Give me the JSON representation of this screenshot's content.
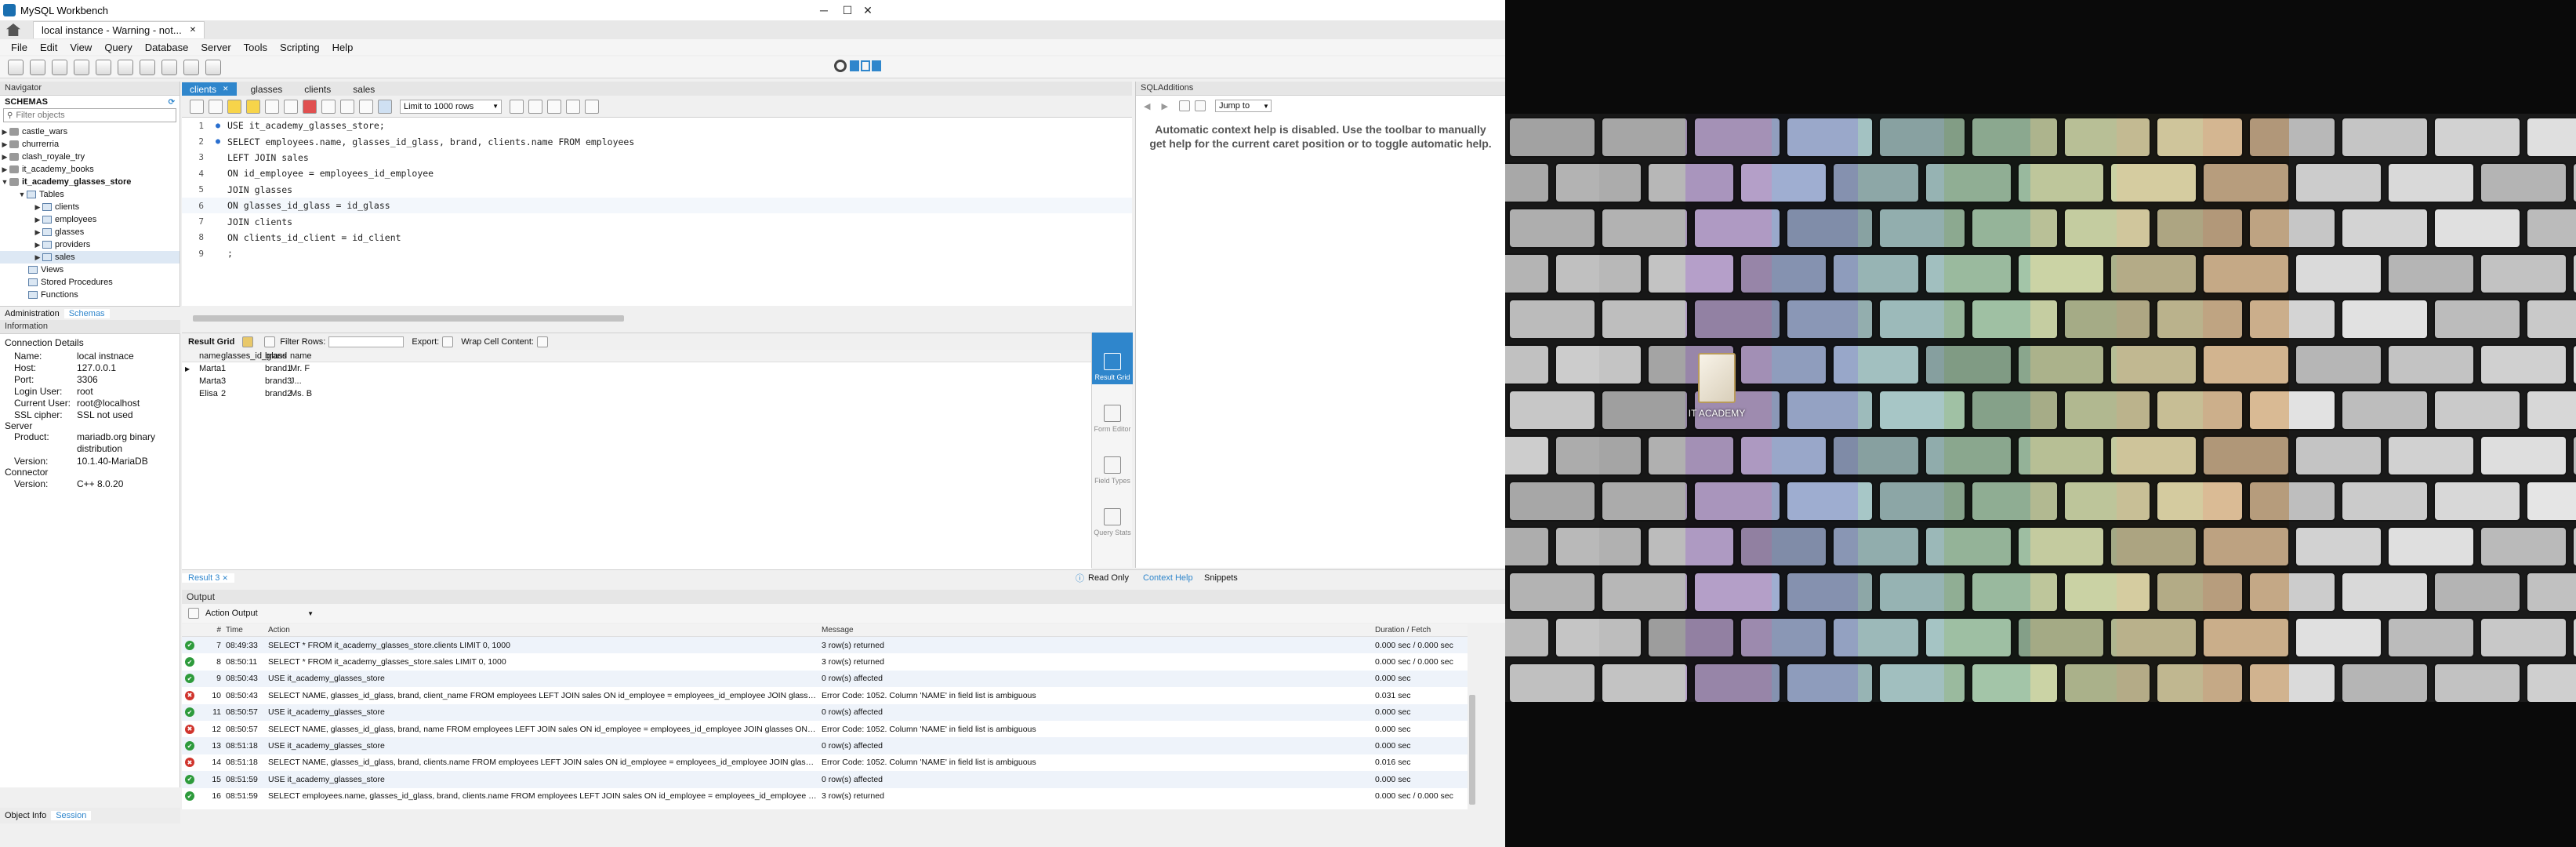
{
  "window": {
    "title": "MySQL Workbench",
    "doc_tab": "local instance - Warning - not...",
    "minimize": "─",
    "maximize": "☐",
    "close": "✕"
  },
  "menu": [
    "File",
    "Edit",
    "View",
    "Query",
    "Database",
    "Server",
    "Tools",
    "Scripting",
    "Help"
  ],
  "navigator": {
    "title": "Navigator",
    "schemas_label": "SCHEMAS",
    "filter_placeholder": "Filter objects",
    "schemas": [
      "castle_wars",
      "churrerria",
      "clash_royale_try",
      "it_academy_books",
      "it_academy_glasses_store"
    ],
    "tables_label": "Tables",
    "tables": [
      "clients",
      "employees",
      "glasses",
      "providers",
      "sales"
    ],
    "other": [
      "Views",
      "Stored Procedures",
      "Functions"
    ],
    "tabs": [
      "Administration",
      "Schemas"
    ]
  },
  "information": {
    "title": "Information",
    "conn_header": "Connection Details",
    "rows": [
      [
        "Name:",
        "local instnace"
      ],
      [
        "Host:",
        "127.0.0.1"
      ],
      [
        "Port:",
        "3306"
      ],
      [
        "Login User:",
        "root"
      ],
      [
        "Current User:",
        "root@localhost"
      ],
      [
        "SSL cipher:",
        "SSL not used"
      ]
    ],
    "server_header": "Server",
    "server_rows": [
      [
        "Product:",
        "mariadb.org binary distribution"
      ],
      [
        "Version:",
        "10.1.40-MariaDB"
      ]
    ],
    "connector_header": "Connector",
    "connector_rows": [
      [
        "Version:",
        "C++ 8.0.20"
      ]
    ],
    "tabs": [
      "Object Info",
      "Session"
    ]
  },
  "editor": {
    "tabs": [
      "clients",
      "glasses",
      "clients",
      "sales"
    ],
    "limit": "Limit to 1000 rows",
    "lines": [
      "USE it_academy_glasses_store;",
      "SELECT employees.name, glasses_id_glass, brand, clients.name FROM employees",
      "LEFT JOIN sales",
      "ON id_employee = employees_id_employee",
      "JOIN glasses",
      "ON glasses_id_glass = id_glass",
      "JOIN clients",
      "ON clients_id_client = id_client",
      ";"
    ]
  },
  "results": {
    "toolbar": {
      "grid": "Result Grid",
      "filter": "Filter Rows:",
      "export": "Export:",
      "wrap": "Wrap Cell Content:"
    },
    "columns": [
      "name",
      "glasses_id_glass",
      "brand",
      "name"
    ],
    "rows": [
      [
        "Marta",
        "1",
        "brand1",
        "Mr. F"
      ],
      [
        "Marta",
        "3",
        "brand3",
        "J..."
      ],
      [
        "Elisa",
        "2",
        "brand2",
        "Ms. B"
      ]
    ],
    "side": [
      "Result Grid",
      "Form Editor",
      "Field Types",
      "Query Stats"
    ],
    "tab": "Result 3",
    "readonly": "Read Only"
  },
  "sql_additions": {
    "title": "SQLAdditions",
    "jump": "Jump to",
    "help": "Automatic context help is disabled. Use the toolbar to manually get help for the current caret position or to toggle automatic help.",
    "tabs": [
      "Context Help",
      "Snippets"
    ]
  },
  "output": {
    "title": "Output",
    "mode": "Action Output",
    "headers": [
      "#",
      "Time",
      "Action",
      "Message",
      "Duration / Fetch"
    ],
    "rows": [
      {
        "ok": true,
        "n": "7",
        "t": "08:49:33",
        "a": "SELECT * FROM it_academy_glasses_store.clients LIMIT 0, 1000",
        "m": "3 row(s) returned",
        "d": "0.000 sec / 0.000 sec"
      },
      {
        "ok": true,
        "n": "8",
        "t": "08:50:11",
        "a": "SELECT * FROM it_academy_glasses_store.sales LIMIT 0, 1000",
        "m": "3 row(s) returned",
        "d": "0.000 sec / 0.000 sec"
      },
      {
        "ok": true,
        "n": "9",
        "t": "08:50:43",
        "a": "USE it_academy_glasses_store",
        "m": "0 row(s) affected",
        "d": "0.000 sec"
      },
      {
        "ok": false,
        "n": "10",
        "t": "08:50:43",
        "a": "SELECT NAME, glasses_id_glass, brand, client_name FROM employees LEFT JOIN sales ON id_employee = employees_id_employee JOIN glasses ...",
        "m": "Error Code: 1052. Column 'NAME' in field list is ambiguous",
        "d": "0.031 sec"
      },
      {
        "ok": true,
        "n": "11",
        "t": "08:50:57",
        "a": "USE it_academy_glasses_store",
        "m": "0 row(s) affected",
        "d": "0.000 sec"
      },
      {
        "ok": false,
        "n": "12",
        "t": "08:50:57",
        "a": "SELECT NAME, glasses_id_glass, brand, name FROM employees LEFT JOIN sales ON id_employee = employees_id_employee JOIN glasses ON gl...",
        "m": "Error Code: 1052. Column 'NAME' in field list is ambiguous",
        "d": "0.000 sec"
      },
      {
        "ok": true,
        "n": "13",
        "t": "08:51:18",
        "a": "USE it_academy_glasses_store",
        "m": "0 row(s) affected",
        "d": "0.000 sec"
      },
      {
        "ok": false,
        "n": "14",
        "t": "08:51:18",
        "a": "SELECT NAME, glasses_id_glass, brand, clients.name FROM employees LEFT JOIN sales ON id_employee = employees_id_employee JOIN glasses...",
        "m": "Error Code: 1052. Column 'NAME' in field list is ambiguous",
        "d": "0.016 sec"
      },
      {
        "ok": true,
        "n": "15",
        "t": "08:51:59",
        "a": "USE it_academy_glasses_store",
        "m": "0 row(s) affected",
        "d": "0.000 sec"
      },
      {
        "ok": true,
        "n": "16",
        "t": "08:51:59",
        "a": "SELECT employees.name, glasses_id_glass, brand, clients.name FROM employees LEFT JOIN sales ON id_employee = employees_id_employee JO...",
        "m": "3 row(s) returned",
        "d": "0.000 sec / 0.000 sec"
      }
    ]
  },
  "desktop": {
    "icon_label": "IT ACADEMY"
  },
  "colors": {
    "accent": "#2f86cc",
    "ok": "#2e9b3c",
    "err": "#d0342c"
  }
}
